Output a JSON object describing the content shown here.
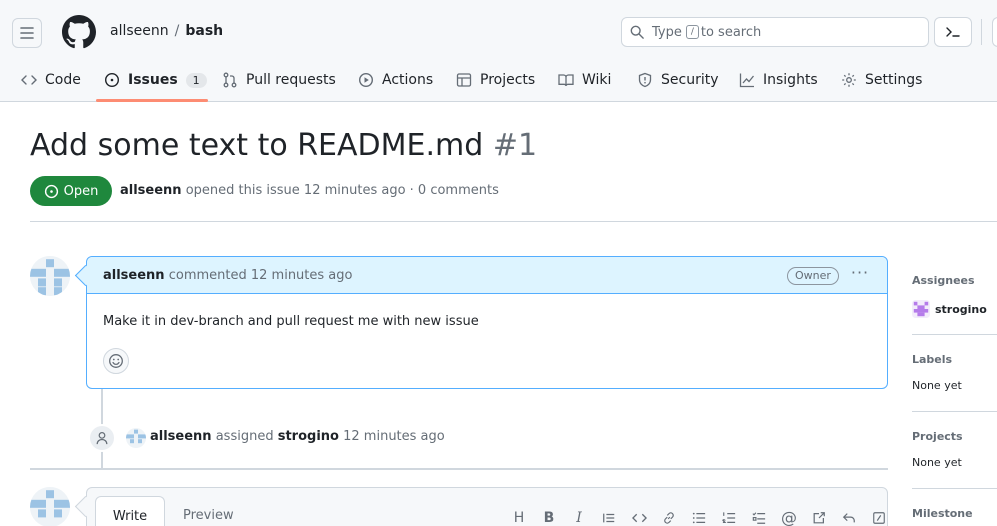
{
  "header": {
    "owner": "allseenn",
    "separator": "/",
    "repo": "bash",
    "search_pre": "Type",
    "search_key": "/",
    "search_post": "to search",
    "cmd_label": ">_"
  },
  "tabs": {
    "code": "Code",
    "issues": "Issues",
    "issues_count": "1",
    "pull_requests": "Pull requests",
    "actions": "Actions",
    "projects": "Projects",
    "wiki": "Wiki",
    "security": "Security",
    "insights": "Insights",
    "settings": "Settings"
  },
  "issue": {
    "title": "Add some text to README.md",
    "number": "#1",
    "state": "Open",
    "author": "allseenn",
    "meta": "opened this issue 12 minutes ago · 0 comments"
  },
  "comment": {
    "author": "allseenn",
    "time": "commented 12 minutes ago",
    "badge": "Owner",
    "more": "···",
    "body": "Make it in dev-branch and pull request me with new issue"
  },
  "event": {
    "actor": "allseenn",
    "action": "assigned",
    "target": "strogino",
    "time": "12 minutes ago"
  },
  "new_comment": {
    "write_tab": "Write",
    "preview_tab": "Preview",
    "toolbar": [
      "H",
      "B",
      "I",
      "quote",
      "code",
      "link",
      "ul",
      "ol",
      "tasks",
      "@",
      "ref",
      "reply",
      "slash"
    ]
  },
  "sidebar": {
    "assignees_label": "Assignees",
    "assignee_name": "strogino",
    "labels_label": "Labels",
    "labels_value": "None yet",
    "projects_label": "Projects",
    "projects_value": "None yet",
    "milestone_label": "Milestone"
  },
  "colors": {
    "open_green": "#1f883d",
    "accent_blue": "#54aeff",
    "tab_underline": "#fd8c73"
  }
}
